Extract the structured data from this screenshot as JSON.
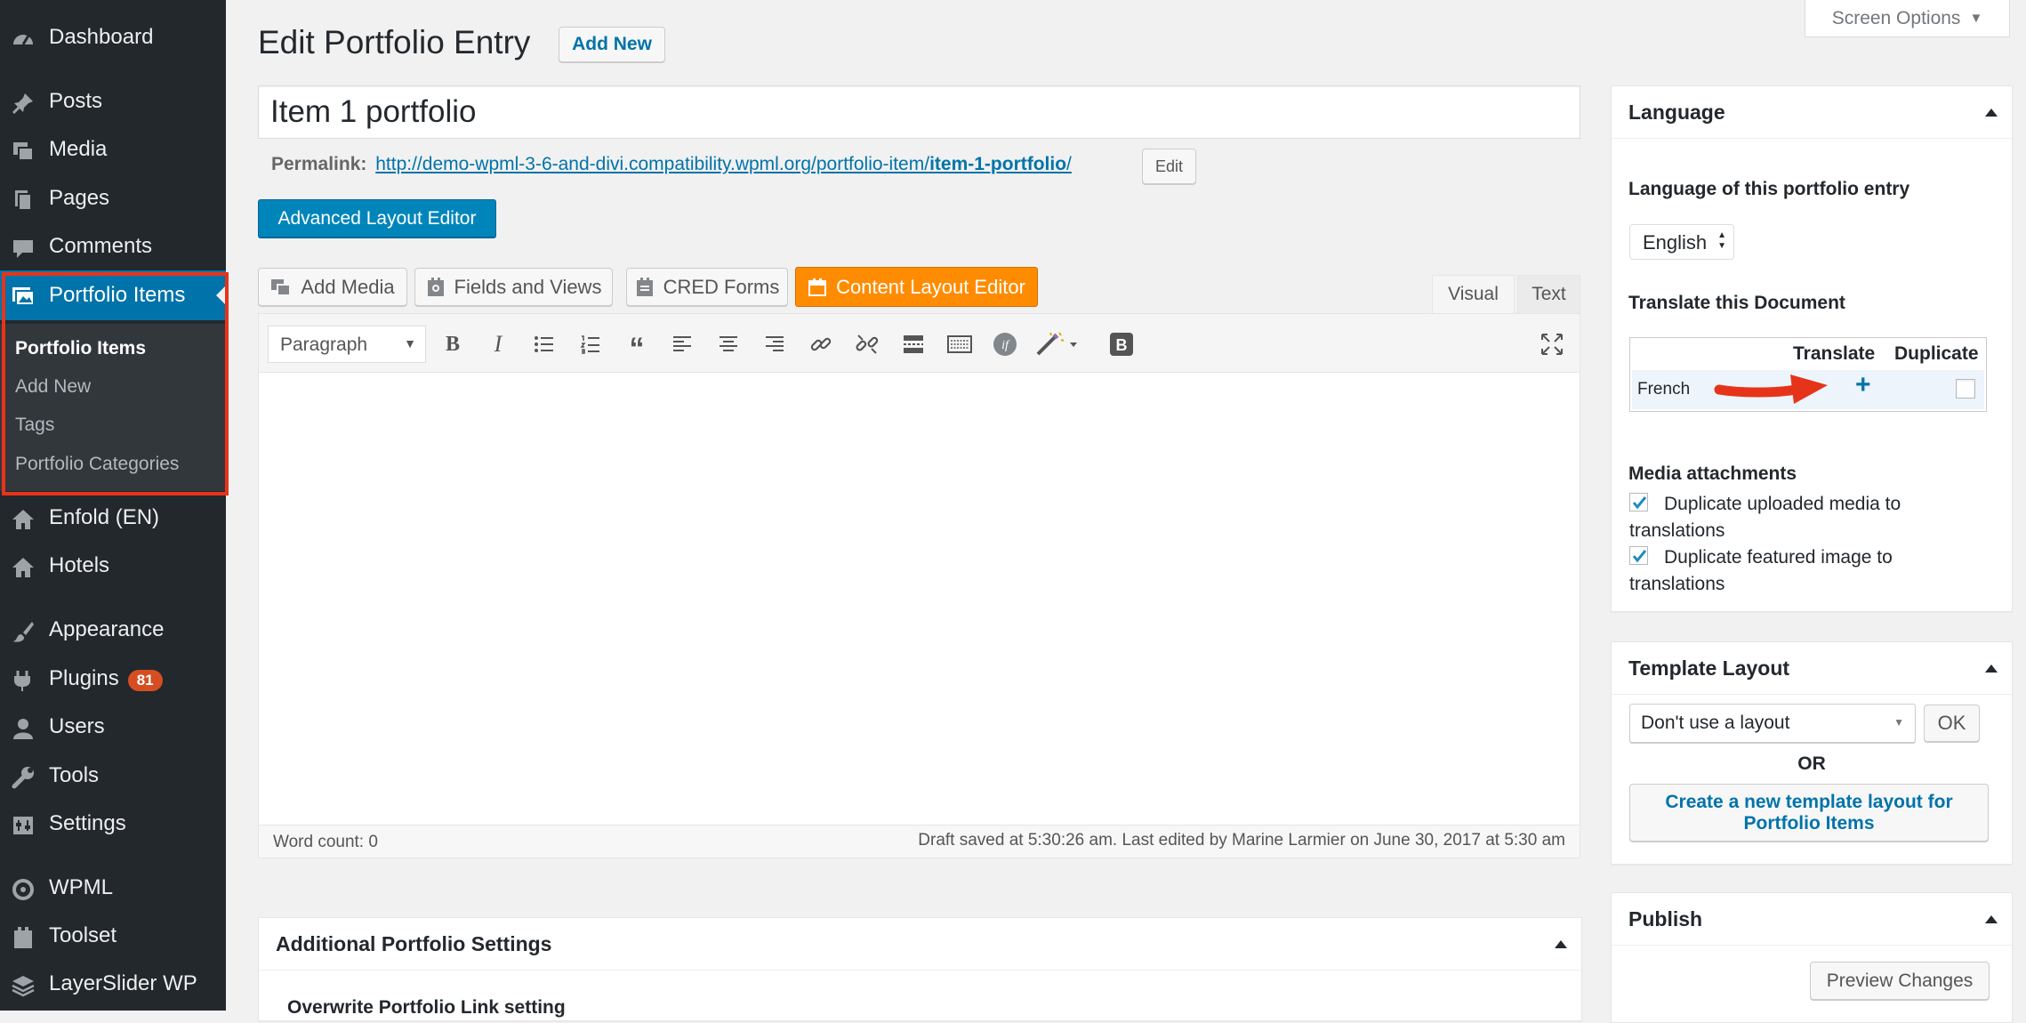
{
  "sidebar": {
    "items": [
      {
        "label": "Dashboard",
        "icon": "dashboard-icon"
      },
      {
        "label": "Posts",
        "icon": "pin-icon"
      },
      {
        "label": "Media",
        "icon": "media-icon"
      },
      {
        "label": "Pages",
        "icon": "pages-icon"
      },
      {
        "label": "Comments",
        "icon": "comment-icon"
      },
      {
        "label": "Portfolio Items",
        "icon": "portfolio-icon"
      },
      {
        "label": "Enfold (EN)",
        "icon": "home-icon"
      },
      {
        "label": "Hotels",
        "icon": "home-icon"
      },
      {
        "label": "Appearance",
        "icon": "brush-icon"
      },
      {
        "label": "Plugins",
        "icon": "plugin-icon",
        "badge": "81"
      },
      {
        "label": "Users",
        "icon": "user-icon"
      },
      {
        "label": "Tools",
        "icon": "wrench-icon"
      },
      {
        "label": "Settings",
        "icon": "settings-icon"
      },
      {
        "label": "WPML",
        "icon": "wpml-icon"
      },
      {
        "label": "Toolset",
        "icon": "toolset-icon"
      },
      {
        "label": "LayerSlider WP",
        "icon": "layerslider-icon"
      }
    ],
    "submenu": [
      "Portfolio Items",
      "Add New",
      "Tags",
      "Portfolio Categories"
    ]
  },
  "screen_options": "Screen Options",
  "page": {
    "title": "Edit Portfolio Entry",
    "add_new": "Add New"
  },
  "post": {
    "title_value": "Item 1 portfolio",
    "permalink_label": "Permalink:",
    "permalink_base": "http://demo-wpml-3-6-and-divi.compatibility.wpml.org/portfolio-item/",
    "permalink_slug": "item-1-portfolio",
    "permalink_trailing": "/",
    "edit_label": "Edit"
  },
  "advanced_layout_editor": "Advanced Layout Editor",
  "media_buttons": [
    "Add Media",
    "Fields and Views",
    "CRED Forms",
    "Content Layout Editor"
  ],
  "editor_tabs": [
    "Visual",
    "Text"
  ],
  "toolbar": {
    "format_select": "Paragraph"
  },
  "word_count": "Word count: 0",
  "draft_status": "Draft saved at 5:30:26 am. Last edited by Marine Larmier on June 30, 2017 at 5:30 am",
  "additional": {
    "title": "Additional Portfolio Settings",
    "partial_label": "Overwrite Portfolio Link setting"
  },
  "language_box": {
    "title": "Language",
    "lang_label": "Language of this portfolio entry",
    "lang_value": "English",
    "translate_label": "Translate this Document",
    "col_translate": "Translate",
    "col_duplicate": "Duplicate",
    "row_lang": "French",
    "media_title": "Media attachments",
    "opt1": "Duplicate uploaded media to translations",
    "opt2": "Duplicate featured image to translations"
  },
  "template_box": {
    "title": "Template Layout",
    "select_value": "Don't use a layout",
    "ok": "OK",
    "or": "OR",
    "create_line1": "Create a new template layout for",
    "create_line2": "Portfolio Items"
  },
  "publish_box": {
    "title": "Publish",
    "preview": "Preview Changes"
  },
  "colors": {
    "sidebar_bg": "#23282d",
    "accent": "#0073aa",
    "orange_btn": "#ff8c00",
    "annotation_red": "#e6341a"
  }
}
